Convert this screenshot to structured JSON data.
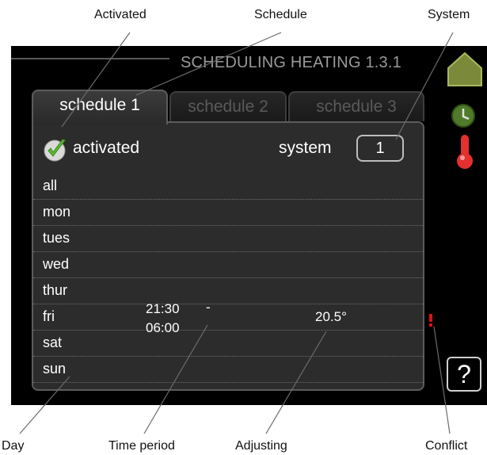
{
  "callouts": {
    "activated": "Activated",
    "schedule": "Schedule",
    "system": "System",
    "day": "Day",
    "time_period": "Time period",
    "adjusting": "Adjusting",
    "conflict": "Conflict"
  },
  "screen": {
    "title": "SCHEDULING HEATING 1.3.1",
    "tabs": [
      {
        "label": "schedule 1",
        "active": true
      },
      {
        "label": "schedule 2",
        "active": false
      },
      {
        "label": "schedule 3",
        "active": false
      }
    ],
    "activated_label": "activated",
    "system_label": "system",
    "system_value": "1",
    "days": [
      "all",
      "mon",
      "tues",
      "wed",
      "thur",
      "fri",
      "sat",
      "sun"
    ],
    "time_start": "21:30",
    "time_dash": "-",
    "time_end": "06:00",
    "temperature": "20.5°",
    "help_label": "?"
  },
  "colors": {
    "screen_bg": "#000000",
    "panel_bg": "#2c2c2c",
    "check_green": "#5cb830",
    "house_green": "#7a8a3a",
    "conflict_red": "#e01010"
  },
  "icons": [
    "check-icon",
    "house-icon",
    "clock-icon",
    "thermometer-icon",
    "help-icon"
  ]
}
